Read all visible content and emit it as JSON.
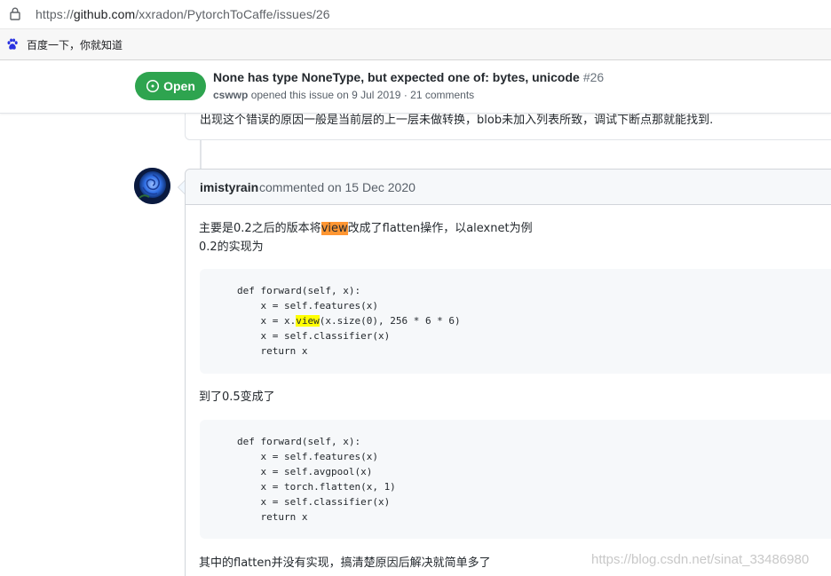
{
  "browser": {
    "url_prefix": "https://",
    "url_host": "github.com",
    "url_path": "/xxradon/PytorchToCaffe/issues/26",
    "bookmark_label": "百度一下，你就知道",
    "icons": {
      "lock": "lock-icon",
      "bookmark": "baidu-paw-icon"
    }
  },
  "issue": {
    "state_label": "Open",
    "title": "None has type NoneType, but expected one of: bytes, unicode",
    "number": "#26",
    "author": "cswwp",
    "meta_rest": " opened this issue on 9 Jul 2019 · 21 comments",
    "state_color": "#2ea44f"
  },
  "previous_comment": {
    "text": "出现这个错误的原因一般是当前层的上一层未做转换，blob未加入列表所致，调试下断点那就能找到."
  },
  "comment": {
    "author": "imistyrain",
    "action": "commented on 15 Dec 2020",
    "line1_before": "主要是0.2之后的版本将",
    "line1_highlight": "view",
    "line1_after": "改成了flatten操作，以alexnet为例",
    "line2": "0.2的实现为",
    "code1": {
      "l1": "def forward(self, x):",
      "l2": "    x = self.features(x)",
      "l3_before": "    x = x.",
      "l3_highlight": "view",
      "l3_after": "(x.size(0), 256 * 6 * 6)",
      "l4": "    x = self.classifier(x)",
      "l5": "    return x"
    },
    "line3": "到了0.5变成了",
    "code2": {
      "l1": "def forward(self, x):",
      "l2": "    x = self.features(x)",
      "l3": "    x = self.avgpool(x)",
      "l4": "    x = torch.flatten(x, 1)",
      "l5": "    x = self.classifier(x)",
      "l6": "    return x"
    },
    "line4": "其中的flatten并没有实现，搞清楚原因后解决就简单多了"
  },
  "watermark": "https://blog.csdn.net/sinat_33486980"
}
